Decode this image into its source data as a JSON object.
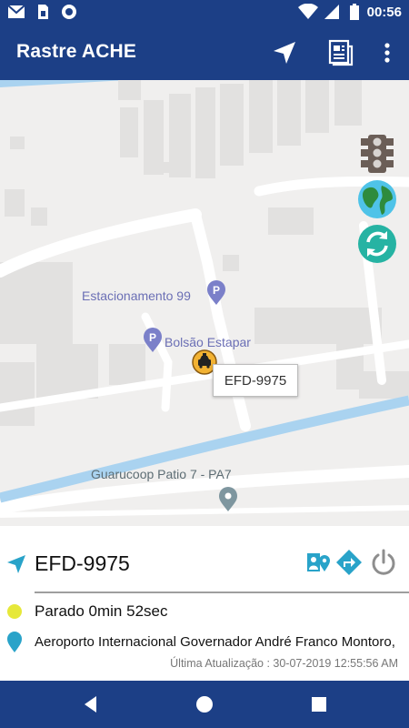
{
  "status_bar": {
    "time": "00:56",
    "left_icons": [
      "gmail-icon",
      "sim-card-icon",
      "record-icon"
    ],
    "right_icons": [
      "wifi-icon",
      "signal-icon",
      "battery-icon"
    ]
  },
  "app_bar": {
    "title": "Rastre ACHE",
    "actions": [
      "navigation-arrow-icon",
      "report-icon",
      "more-vert-icon"
    ]
  },
  "map": {
    "pois": [
      {
        "label": "Estacionamento 99",
        "icon": "parking-pin-icon"
      },
      {
        "label": "Bolsão Estapar",
        "icon": "parking-pin-icon"
      },
      {
        "label": "Guarucoop Patio 7 - PA7",
        "icon": "location-pin-icon"
      }
    ],
    "vehicle_marker": {
      "icon": "taxi-icon",
      "info_window_text": "EFD-9975"
    },
    "controls": [
      "traffic-light-icon",
      "globe-icon",
      "refresh-icon"
    ]
  },
  "vehicle_panel": {
    "plate": "EFD-9975",
    "status": "Parado 0min 52sec",
    "status_color": "#e6e83a",
    "address": "Aeroporto Internacional Governador André Franco Montoro,",
    "last_update_label": "Última Atualização : 30-07-2019 12:55:56 AM",
    "actions": [
      "person-location-icon",
      "directions-icon",
      "power-icon"
    ]
  },
  "nav_bar": {
    "buttons": [
      "back-icon",
      "home-icon",
      "recents-icon"
    ]
  },
  "colors": {
    "primary": "#1c3f86",
    "accent": "#29a3c9",
    "water": "#aad3f0"
  }
}
